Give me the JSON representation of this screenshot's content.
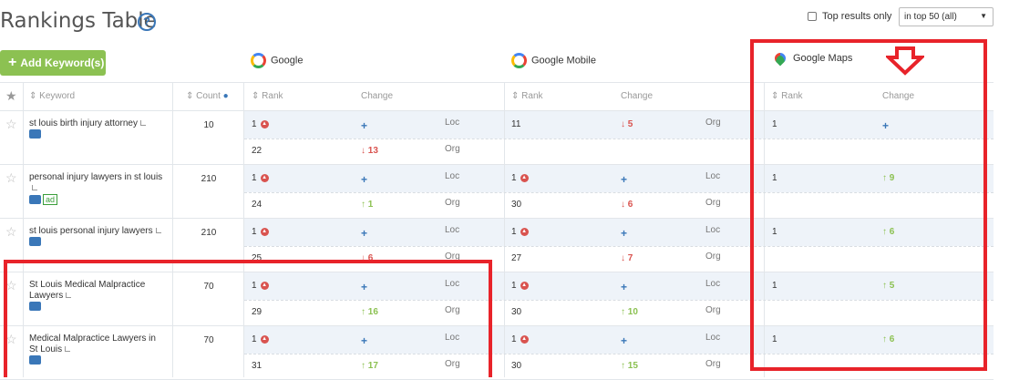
{
  "page": {
    "title": "Rankings Table"
  },
  "filters": {
    "top_results_label": "Top results only",
    "top_results_checked": false,
    "range_select": "in top 50 (all)"
  },
  "toolbar": {
    "add_keyword_label": "Add Keyword(s)"
  },
  "engines": {
    "google": "Google",
    "google_mobile": "Google Mobile",
    "google_maps": "Google Maps"
  },
  "columns": {
    "keyword": "Keyword",
    "count": "Count",
    "rank": "Rank",
    "change": "Change"
  },
  "rows": [
    {
      "keyword": "st louis birth injury attorney",
      "count": "10",
      "ad": "",
      "g1": {
        "rank": "1",
        "badge": true,
        "change": "+",
        "change_type": "new",
        "tag": "Loc"
      },
      "g2": {
        "rank": "22",
        "badge": false,
        "change": "13",
        "change_type": "down",
        "tag": "Org"
      },
      "m1": {
        "rank": "11",
        "badge": false,
        "change": "5",
        "change_type": "down",
        "tag": "Org"
      },
      "m2": {
        "rank": "",
        "badge": false,
        "change": "",
        "change_type": "",
        "tag": ""
      },
      "maps": {
        "rank": "1",
        "change": "+",
        "change_type": "new"
      }
    },
    {
      "keyword": "personal injury lawyers in st louis",
      "count": "210",
      "ad": "ad",
      "g1": {
        "rank": "1",
        "badge": true,
        "change": "+",
        "change_type": "new",
        "tag": "Loc"
      },
      "g2": {
        "rank": "24",
        "badge": false,
        "change": "1",
        "change_type": "up",
        "tag": "Org"
      },
      "m1": {
        "rank": "1",
        "badge": true,
        "change": "+",
        "change_type": "new",
        "tag": "Loc"
      },
      "m2": {
        "rank": "30",
        "badge": false,
        "change": "6",
        "change_type": "down",
        "tag": "Org"
      },
      "maps": {
        "rank": "1",
        "change": "9",
        "change_type": "up"
      }
    },
    {
      "keyword": "st louis personal injury lawyers",
      "count": "210",
      "ad": "",
      "g1": {
        "rank": "1",
        "badge": true,
        "change": "+",
        "change_type": "new",
        "tag": "Loc"
      },
      "g2": {
        "rank": "25",
        "badge": false,
        "change": "6",
        "change_type": "down",
        "tag": "Org"
      },
      "m1": {
        "rank": "1",
        "badge": true,
        "change": "+",
        "change_type": "new",
        "tag": "Loc"
      },
      "m2": {
        "rank": "27",
        "badge": false,
        "change": "7",
        "change_type": "down",
        "tag": "Org"
      },
      "maps": {
        "rank": "1",
        "change": "6",
        "change_type": "up"
      }
    },
    {
      "keyword": "St Louis Medical Malpractice Lawyers",
      "count": "70",
      "ad": "",
      "g1": {
        "rank": "1",
        "badge": true,
        "change": "+",
        "change_type": "new",
        "tag": "Loc"
      },
      "g2": {
        "rank": "29",
        "badge": false,
        "change": "16",
        "change_type": "up",
        "tag": "Org"
      },
      "m1": {
        "rank": "1",
        "badge": true,
        "change": "+",
        "change_type": "new",
        "tag": "Loc"
      },
      "m2": {
        "rank": "30",
        "badge": false,
        "change": "10",
        "change_type": "up",
        "tag": "Org"
      },
      "maps": {
        "rank": "1",
        "change": "5",
        "change_type": "up"
      }
    },
    {
      "keyword": "Medical Malpractice Lawyers in St Louis",
      "count": "70",
      "ad": "",
      "g1": {
        "rank": "1",
        "badge": true,
        "change": "+",
        "change_type": "new",
        "tag": "Loc"
      },
      "g2": {
        "rank": "31",
        "badge": false,
        "change": "17",
        "change_type": "up",
        "tag": "Org"
      },
      "m1": {
        "rank": "1",
        "badge": true,
        "change": "+",
        "change_type": "new",
        "tag": "Loc"
      },
      "m2": {
        "rank": "30",
        "badge": false,
        "change": "15",
        "change_type": "up",
        "tag": "Org"
      },
      "maps": {
        "rank": "1",
        "change": "6",
        "change_type": "up"
      }
    }
  ],
  "icons": {
    "help": "question-circle-icon",
    "star": "star-icon",
    "chart": "bar-chart-icon",
    "local": "local-pack-icon",
    "arrow": "arrow-down-icon"
  },
  "colors": {
    "accent_green": "#8cc152",
    "down_red": "#d9534f",
    "new_blue": "#3a77b8",
    "annotation_red": "#e8232a"
  }
}
